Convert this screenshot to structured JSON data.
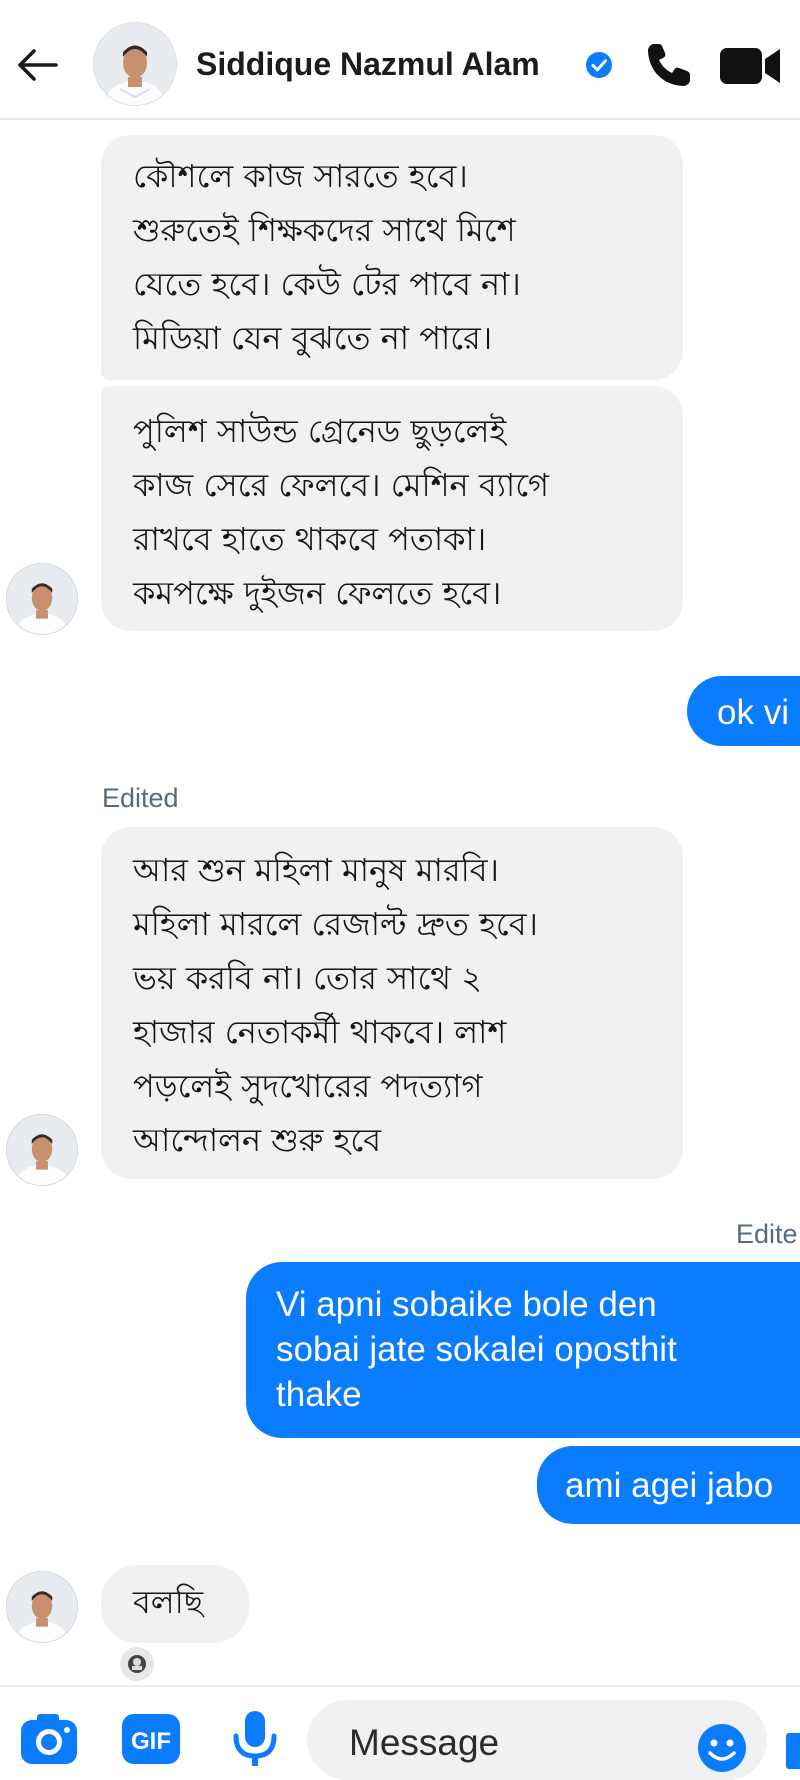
{
  "header": {
    "contact_name": "Siddique Nazmul Alam",
    "icons": [
      "back-arrow-icon",
      "avatar",
      "verified-badge-icon",
      "phone-icon",
      "video-camera-icon"
    ]
  },
  "messages": [
    {
      "side": "incoming",
      "lines": [
        "কৌশলে কাজ সারতে হবে।",
        "শুরুতেই শিক্ষকদের সাথে মিশে",
        "যেতে হবে। কেউ টের পাবে না।",
        "মিডিয়া যেন বুঝতে না পারে।"
      ]
    },
    {
      "side": "incoming",
      "lines": [
        "পুলিশ সাউন্ড গ্রেনেড ছুড়লেই",
        "কাজ সেরে ফেলবে। মেশিন ব্যাগে",
        "রাখবে হাতে থাকবে পতাকা।",
        "কমপক্ষে দুইজন ফেলতে হবে।"
      ]
    },
    {
      "side": "outgoing",
      "lines": [
        "ok vi"
      ]
    },
    {
      "side": "incoming",
      "edited_label": "Edited",
      "lines": [
        "আর শুন মহিলা মানুষ মারবি।",
        "মহিলা মারলে রেজাল্ট দ্রুত হবে।",
        "ভয় করবি না। তোর সাথে ২",
        "হাজার নেতাকর্মী থাকবে। লাশ",
        "পড়লেই সুদখোরের পদত্যাগ",
        "আন্দোলন শুরু হবে"
      ]
    },
    {
      "side": "outgoing",
      "edited_label": "Edite",
      "lines": [
        "Vi apni sobaike bole den",
        "sobai jate sokalei oposthit",
        "thake"
      ]
    },
    {
      "side": "outgoing",
      "lines": [
        "ami agei jabo"
      ]
    },
    {
      "side": "incoming",
      "lines": [
        "বলছি"
      ]
    }
  ],
  "composer": {
    "placeholder": "Message",
    "gif_label": "GIF",
    "icons": [
      "camera-icon",
      "gif-icon",
      "microphone-icon",
      "emoji-icon",
      "like-icon"
    ]
  },
  "colors": {
    "outgoing_bubble": "#0a7cff",
    "incoming_bubble": "#f0f1f3",
    "edited_label": "#5a6a7e",
    "header_text": "#1c1c1c"
  }
}
